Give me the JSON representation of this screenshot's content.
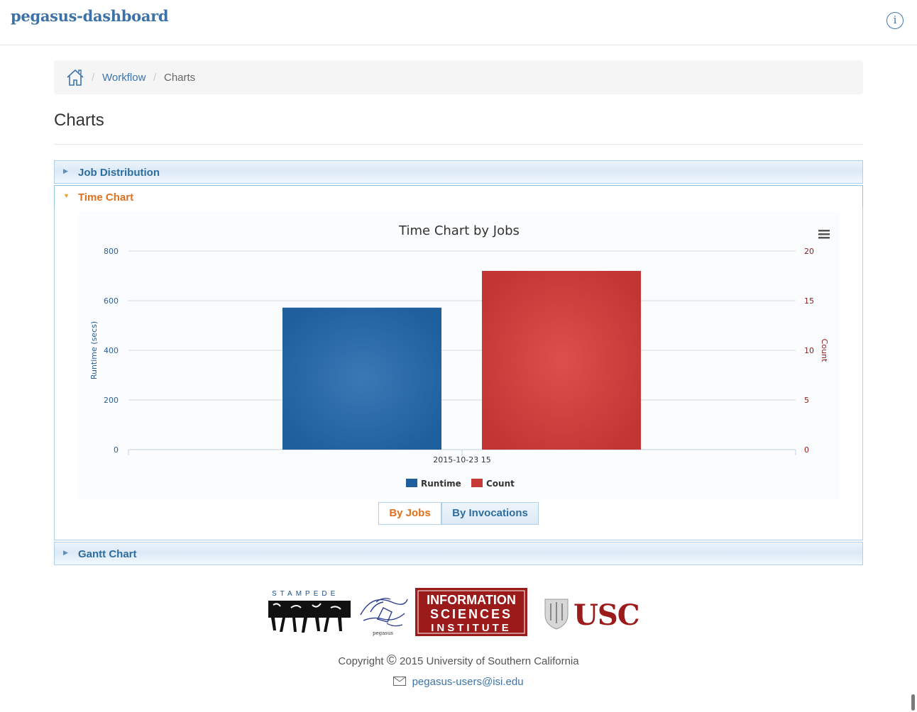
{
  "app": {
    "brand": "pegasus-dashboard",
    "info_icon": "info-icon"
  },
  "breadcrumb": {
    "home_icon": "home-icon",
    "separator": "/",
    "workflow": "Workflow",
    "current": "Charts"
  },
  "page": {
    "title": "Charts"
  },
  "accordion": {
    "job_distribution": "Job Distribution",
    "time_chart": "Time Chart",
    "gantt_chart": "Gantt Chart"
  },
  "chart_data": {
    "type": "bar",
    "title": "Time Chart by Jobs",
    "categories": [
      "2015-10-23 15"
    ],
    "series": [
      {
        "name": "Runtime",
        "values": [
          572
        ],
        "axis": "left",
        "color": "#1f5f9e"
      },
      {
        "name": "Count",
        "values": [
          18
        ],
        "axis": "right",
        "color": "#c83a38"
      }
    ],
    "ylabel": "Runtime (secs)",
    "ylabel_right": "Count",
    "ylim": [
      0,
      800
    ],
    "yticks": [
      "0",
      "200",
      "400",
      "600",
      "800"
    ],
    "ylim_right": [
      0,
      20
    ],
    "yticks_right": [
      "0",
      "5",
      "10",
      "15",
      "20"
    ],
    "grid": true,
    "legend": "bottom-center",
    "menu_icon": "menu-icon"
  },
  "chart_toggle": {
    "by_jobs": "By Jobs",
    "by_invocations": "By Invocations"
  },
  "footer": {
    "logos": {
      "stampede": "STAMPEDE",
      "pegasus": "pegasus",
      "isi": [
        "INFORMATION",
        "SCIENCES",
        "INSTITUTE"
      ],
      "usc": "USC"
    },
    "copyright_prefix": "Copyright",
    "copyright_symbol": "©",
    "copyright_text": "2015 University of Southern California",
    "email": "pegasus-users@isi.edu"
  },
  "colors": {
    "link": "#3b74ad",
    "accent_orange": "#e0711e",
    "runtime": "#1f5f9e",
    "count": "#c83a38"
  }
}
